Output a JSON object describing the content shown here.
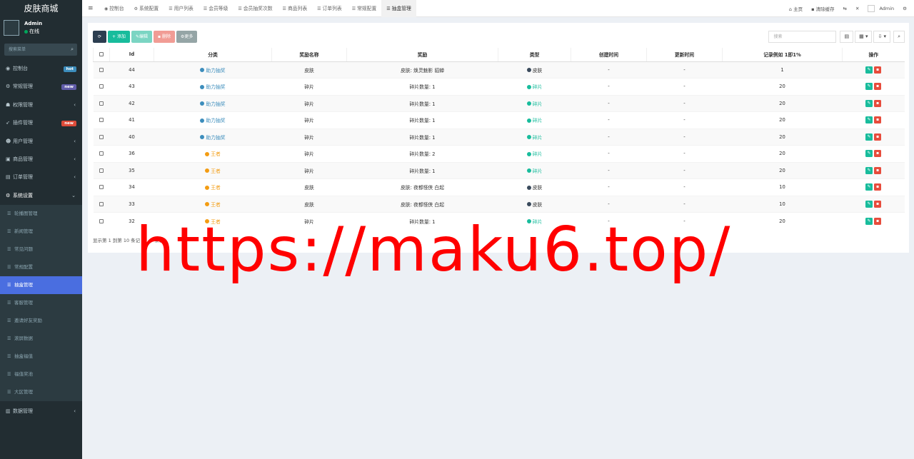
{
  "brand": "皮肤商城",
  "user": {
    "name": "Admin",
    "status": "在线"
  },
  "sidebar_search_placeholder": "搜索菜单",
  "menu": [
    {
      "label": "控制台",
      "icon": "dashboard-icon",
      "badge": "hot",
      "badge_color": "#3c8dbc"
    },
    {
      "label": "常规管理",
      "icon": "cogs-icon",
      "badge": "new",
      "badge_color": "#605ca8"
    },
    {
      "label": "权限管理",
      "icon": "group-icon",
      "chevron": "‹"
    },
    {
      "label": "插件管理",
      "icon": "rocket-icon",
      "badge": "new",
      "badge_color": "#dd4b39"
    },
    {
      "label": "用户管理",
      "icon": "user-circle-icon",
      "chevron": "‹"
    },
    {
      "label": "商品管理",
      "icon": "shopping-bag-icon",
      "chevron": "‹"
    },
    {
      "label": "订单管理",
      "icon": "file-icon",
      "chevron": "‹"
    },
    {
      "label": "系统设置",
      "icon": "gear-icon",
      "chevron": "⌄"
    }
  ],
  "submenu": [
    {
      "label": "轮播图管理"
    },
    {
      "label": "新闻管理"
    },
    {
      "label": "常见问题"
    },
    {
      "label": "常规配置"
    },
    {
      "label": "抽盒管理",
      "active": true
    },
    {
      "label": "客服管理"
    },
    {
      "label": "邀请好友奖励"
    },
    {
      "label": "滚屏数据"
    },
    {
      "label": "抽盒福值"
    },
    {
      "label": "福值奖池"
    },
    {
      "label": "大区管理"
    }
  ],
  "menu_last": {
    "label": "数据管理",
    "icon": "database-icon",
    "chevron": "‹"
  },
  "tabs": [
    {
      "label": "控制台",
      "icon": "dashboard-icon"
    },
    {
      "label": "系统配置",
      "icon": "gear-icon"
    },
    {
      "label": "用户列表",
      "icon": "list-icon"
    },
    {
      "label": "会员等级",
      "icon": "list-icon"
    },
    {
      "label": "会员抽奖次数",
      "icon": "list-icon"
    },
    {
      "label": "商品列表",
      "icon": "list-icon"
    },
    {
      "label": "订单列表",
      "icon": "list-icon"
    },
    {
      "label": "常规配置",
      "icon": "list-icon"
    },
    {
      "label": "抽盒管理",
      "icon": "list-icon",
      "active": true
    }
  ],
  "topbar_right": {
    "home": "主页",
    "clear_cache": "清除缓存",
    "user": "Admin"
  },
  "toolbar": {
    "add": "添加",
    "edit": "编辑",
    "delete": "删除",
    "more": "更多",
    "search_placeholder": "搜索"
  },
  "table": {
    "headers": [
      "Id",
      "分类",
      "奖励名称",
      "奖励",
      "类型",
      "创建时间",
      "更新时间",
      "记录例如 1即1%",
      "操作"
    ],
    "rows": [
      {
        "id": "44",
        "category": "助力抽奖",
        "cat_color": "blue",
        "name": "皮肤",
        "reward": "皮肤: 焕灵魅影 貂蝉",
        "type": "皮肤",
        "type_color": "dark",
        "created": "-",
        "updated": "-",
        "record": "1"
      },
      {
        "id": "43",
        "category": "助力抽奖",
        "cat_color": "blue",
        "name": "碎片",
        "reward": "碎片数量: 1",
        "type": "碎片",
        "type_color": "green",
        "created": "-",
        "updated": "-",
        "record": "20"
      },
      {
        "id": "42",
        "category": "助力抽奖",
        "cat_color": "blue",
        "name": "碎片",
        "reward": "碎片数量: 1",
        "type": "碎片",
        "type_color": "green",
        "created": "-",
        "updated": "-",
        "record": "20"
      },
      {
        "id": "41",
        "category": "助力抽奖",
        "cat_color": "blue",
        "name": "碎片",
        "reward": "碎片数量: 1",
        "type": "碎片",
        "type_color": "green",
        "created": "-",
        "updated": "-",
        "record": "20"
      },
      {
        "id": "40",
        "category": "助力抽奖",
        "cat_color": "blue",
        "name": "碎片",
        "reward": "碎片数量: 1",
        "type": "碎片",
        "type_color": "green",
        "created": "-",
        "updated": "-",
        "record": "20"
      },
      {
        "id": "36",
        "category": "王者",
        "cat_color": "orange",
        "name": "碎片",
        "reward": "碎片数量: 2",
        "type": "碎片",
        "type_color": "green",
        "created": "-",
        "updated": "-",
        "record": "20"
      },
      {
        "id": "35",
        "category": "王者",
        "cat_color": "orange",
        "name": "碎片",
        "reward": "碎片数量: 1",
        "type": "碎片",
        "type_color": "green",
        "created": "-",
        "updated": "-",
        "record": "20"
      },
      {
        "id": "34",
        "category": "王者",
        "cat_color": "orange",
        "name": "皮肤",
        "reward": "皮肤: 夜都怪侠 白起",
        "type": "皮肤",
        "type_color": "dark",
        "created": "-",
        "updated": "-",
        "record": "10"
      },
      {
        "id": "33",
        "category": "王者",
        "cat_color": "orange",
        "name": "皮肤",
        "reward": "皮肤: 夜都怪侠 白起",
        "type": "皮肤",
        "type_color": "dark",
        "created": "-",
        "updated": "-",
        "record": "10"
      },
      {
        "id": "32",
        "category": "王者",
        "cat_color": "orange",
        "name": "碎片",
        "reward": "碎片数量: 1",
        "type": "碎片",
        "type_color": "green",
        "created": "-",
        "updated": "-",
        "record": "20"
      }
    ]
  },
  "footer_text_left": "显示第 1 到第 10 条记",
  "footer_text_right": "条记",
  "watermark": "https://maku6.top/",
  "colors": {
    "sidebar_bg": "#222d32",
    "active_item": "#4a6ee0",
    "accent_green": "#18bc9c",
    "danger": "#e74c3c",
    "blue": "#3c8dbc",
    "orange": "#f39c12"
  }
}
